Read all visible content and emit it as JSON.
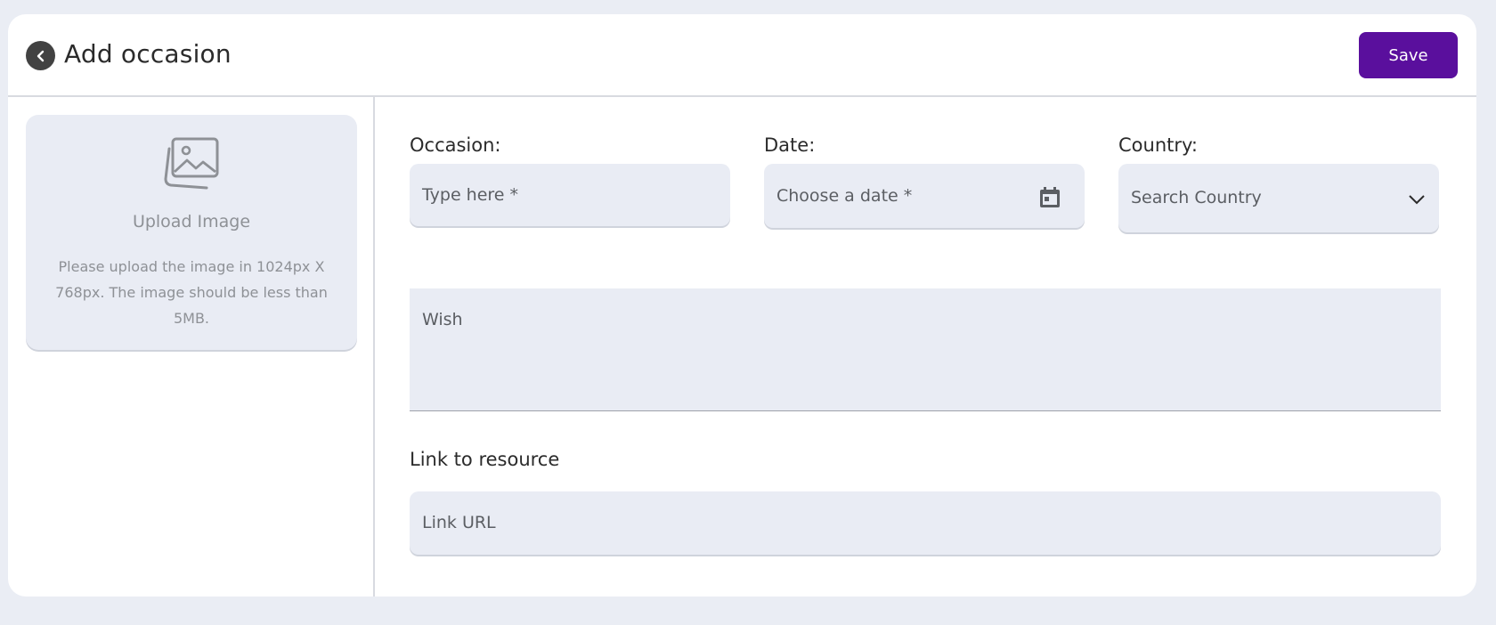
{
  "header": {
    "title": "Add occasion",
    "save_label": "Save",
    "back_icon": "back-arrow-icon",
    "accent_color": "#5a0f9d"
  },
  "upload": {
    "icon": "image-icon",
    "title": "Upload Image",
    "hint": "Please upload the image in 1024px X 768px. The image should be less than 5MB."
  },
  "form": {
    "occasion": {
      "label": "Occasion:",
      "placeholder": "Type here *"
    },
    "date": {
      "label": "Date:",
      "placeholder": "Choose a date *",
      "icon": "calendar-icon"
    },
    "country": {
      "label": "Country:",
      "placeholder": "Search Country",
      "icon": "chevron-down-icon"
    },
    "wish": {
      "placeholder": "Wish"
    },
    "link": {
      "label": "Link to resource",
      "placeholder": "Link URL"
    }
  }
}
